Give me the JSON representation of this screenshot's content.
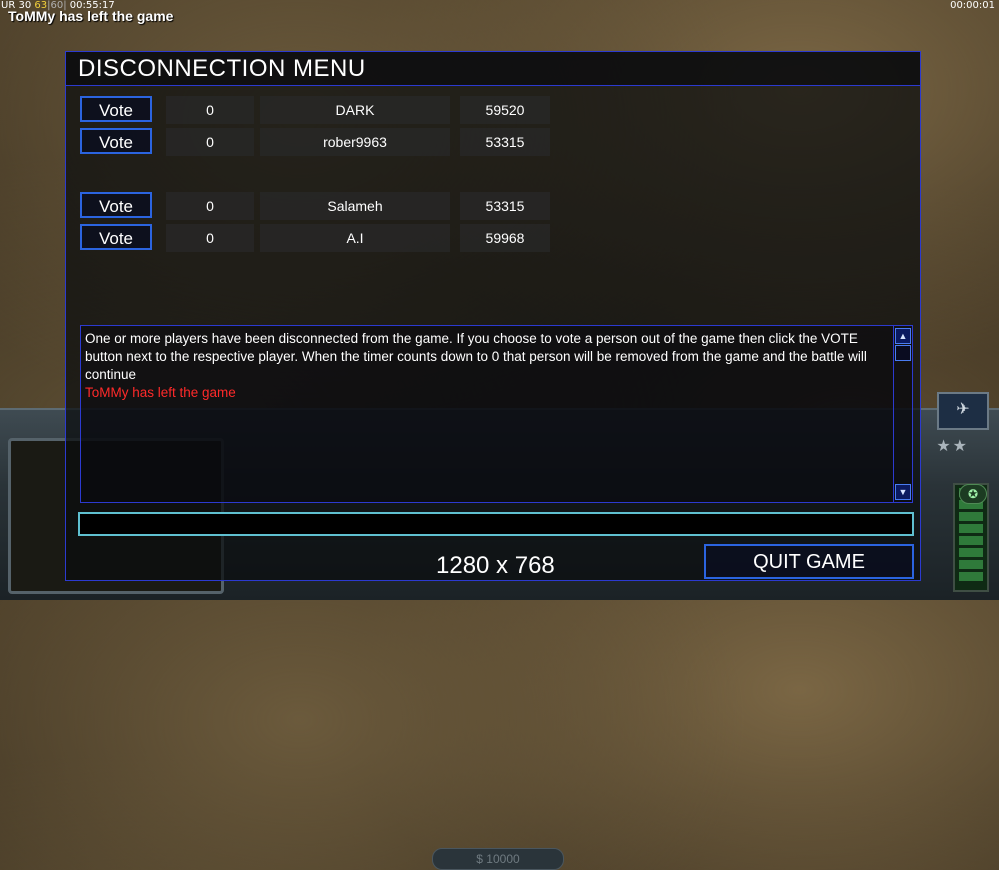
{
  "hud": {
    "stats": {
      "ur_label": "UR",
      "a": "30",
      "b": "63",
      "c": "60",
      "time": "00:55:17"
    },
    "notice": "ToMMy has left the game",
    "clock": "00:00:01",
    "money": "$ 10000"
  },
  "panel": {
    "title": "DISCONNECTION MENU",
    "vote_label": "Vote",
    "players": [
      {
        "count": "0",
        "name": "DARK",
        "score": "59520"
      },
      {
        "count": "0",
        "name": "rober9963",
        "score": "53315"
      },
      {
        "count": "0",
        "name": "Salameh",
        "score": "53315"
      },
      {
        "count": "0",
        "name": "A.I",
        "score": "59968"
      }
    ],
    "message": "One or more players have been disconnected from the game. If you choose to vote a person out of the game then click the VOTE button next to the respective player. When the timer counts down to 0 that person will be removed from the game and the battle will continue",
    "alert": "ToMMy has left the game",
    "resolution": "1280 x 768",
    "quit_label": "QUIT GAME"
  },
  "colors": {
    "border": "#2c3ad0",
    "button_border": "#2b64e0",
    "alert": "#ff2a2a",
    "input_border": "#5fc0d0"
  }
}
